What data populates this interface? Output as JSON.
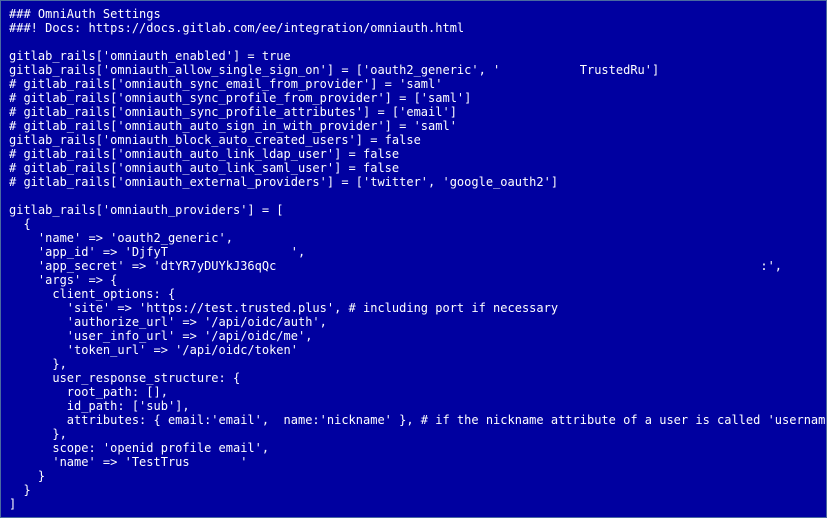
{
  "lines": {
    "l0": "### OmniAuth Settings",
    "l1": "###! Docs: https://docs.gitlab.com/ee/integration/omniauth.html",
    "l2": "",
    "l3": "gitlab_rails['omniauth_enabled'] = true",
    "l4": "gitlab_rails['omniauth_allow_single_sign_on'] = ['oauth2_generic', '           TrustedRu']",
    "l5": "# gitlab_rails['omniauth_sync_email_from_provider'] = 'saml'",
    "l6": "# gitlab_rails['omniauth_sync_profile_from_provider'] = ['saml']",
    "l7": "# gitlab_rails['omniauth_sync_profile_attributes'] = ['email']",
    "l8": "# gitlab_rails['omniauth_auto_sign_in_with_provider'] = 'saml'",
    "l9": "gitlab_rails['omniauth_block_auto_created_users'] = false",
    "l10": "# gitlab_rails['omniauth_auto_link_ldap_user'] = false",
    "l11": "# gitlab_rails['omniauth_auto_link_saml_user'] = false",
    "l12": "# gitlab_rails['omniauth_external_providers'] = ['twitter', 'google_oauth2']",
    "l13": "",
    "l14": "gitlab_rails['omniauth_providers'] = [",
    "l15": "  {",
    "l16": "    'name' => 'oauth2_generic',",
    "l17": "    'app_id' => 'DjfyT                 ',",
    "l18": "    'app_secret' => 'dtYR7yDUYkJ36qQc                                                                   :',",
    "l19": "    'args' => {",
    "l20": "      client_options: {",
    "l21": "        'site' => 'https://test.trusted.plus', # including port if necessary",
    "l22": "        'authorize_url' => '/api/oidc/auth',",
    "l23": "        'user_info_url' => '/api/oidc/me',",
    "l24": "        'token_url' => '/api/oidc/token'",
    "l25": "      },",
    "l26": "      user_response_structure: {",
    "l27": "        root_path: [],",
    "l28": "        id_path: ['sub'],",
    "l29": "        attributes: { email:'email',  name:'nickname' }, # if the nickname attribute of a user is called 'username'",
    "l30": "      },",
    "l31": "      scope: 'openid profile email',",
    "l32": "      'name' => 'TestTrus       '",
    "l33": "    }",
    "l34": "  }",
    "l35": "]"
  }
}
